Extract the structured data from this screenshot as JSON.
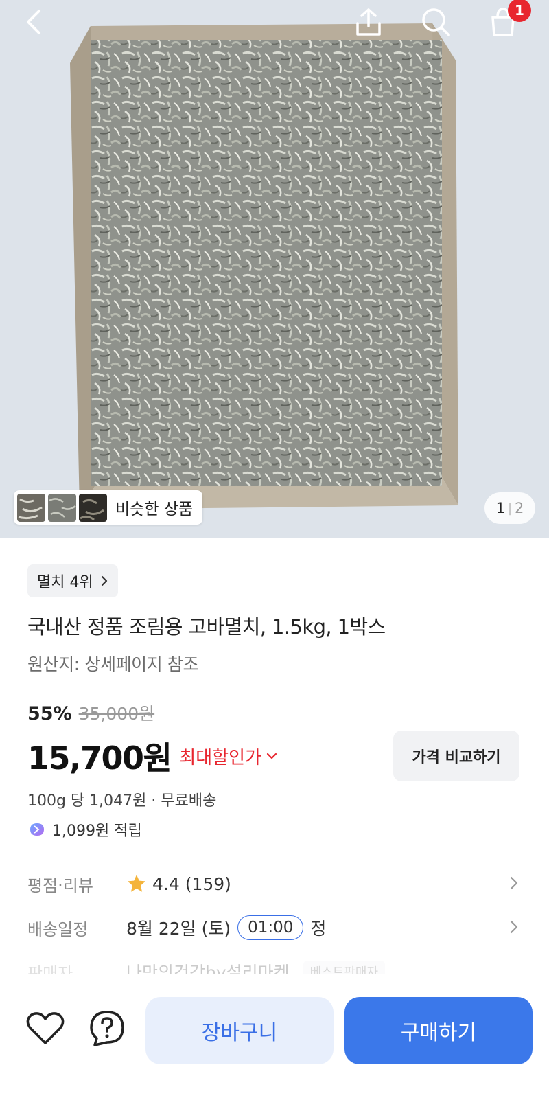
{
  "header": {
    "back_icon": "chevron-left-icon",
    "share_icon": "share-icon",
    "search_icon": "search-icon",
    "cart_icon": "shopping-bag-icon",
    "cart_count": "1"
  },
  "gallery": {
    "similar_label": "비슷한 상품",
    "page_current": "1",
    "page_separator": "|",
    "page_total": "2"
  },
  "product": {
    "rank_label": "멸치 4위",
    "title": "국내산 정품 조림용 고바멸치, 1.5kg, 1박스",
    "origin": "원산지: 상세페이지 참조",
    "discount_rate": "55%",
    "original_price": "35,000원",
    "price": "15,700원",
    "max_discount_label": "최대할인가",
    "compare_button": "가격 비교하기",
    "unit_price_shipping": "100g 당 1,047원 · 무료배송",
    "points": "1,099원 적립"
  },
  "info": {
    "rating_key": "평점·리뷰",
    "rating_value": "4.4 (159)",
    "delivery_key": "배송일정",
    "delivery_date": "8월 22일 (토)",
    "delivery_time": "01:00",
    "delivery_suffix": "정",
    "seller_key": "판매자",
    "seller_name": "나만의건강by설리마켓",
    "seller_badge": "베스트판매자"
  },
  "bottom_bar": {
    "wishlist_icon": "heart-icon",
    "inquiry_icon": "question-icon",
    "cart_button": "장바구니",
    "buy_button": "구매하기"
  },
  "colors": {
    "accent_blue": "#3b78ea",
    "discount_red": "#e8262f",
    "light_blue_bg": "#e8effc"
  }
}
